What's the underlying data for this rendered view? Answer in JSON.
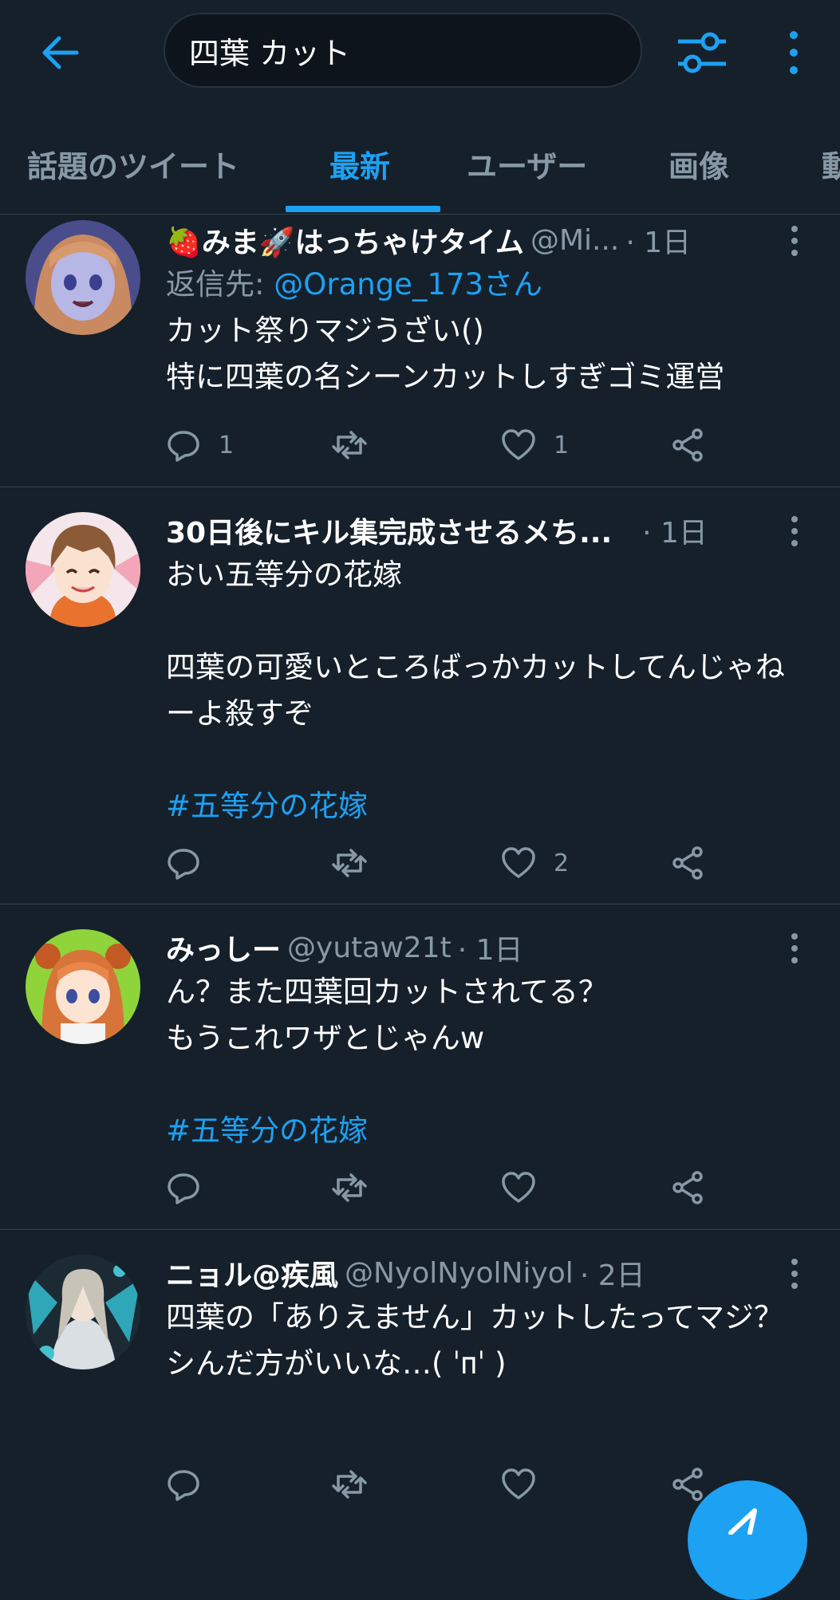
{
  "search": {
    "query": "四葉 カット"
  },
  "tabs": [
    "話題のツイート",
    "最新",
    "ユーザー",
    "画像",
    "動"
  ],
  "tweets": [
    {
      "name": "🍓みま🚀はっちゃけタイム",
      "handle": "@Mi...",
      "time": "· 1日",
      "reply_prefix": "返信先: ",
      "reply_to": "@Orange_173さん",
      "line1": "カット祭りマジうざい()",
      "line2": "特に四葉の名シーンカットしすぎゴミ運営",
      "replies": "1",
      "likes": "1"
    },
    {
      "name": "30日後にキル集完成させるメち...",
      "time": "· 1日",
      "line1": "おい五等分の花嫁",
      "line2": "四葉の可愛いところばっかカットしてんじゃねーよ殺すぞ",
      "hashtag": "#五等分の花嫁",
      "likes": "2"
    },
    {
      "name": "みっしー",
      "handle": "@yutaw21t",
      "time": "· 1日",
      "line1": "ん？また四葉回カットされてる？",
      "line2": "もうこれワザとじゃんw",
      "hashtag": "#五等分の花嫁"
    },
    {
      "name": "ニョル@疾風",
      "handle": "@NyolNyolNiyol",
      "time": "· 2日",
      "line1": "四葉の「ありえません」カットしたってマジ？",
      "line2": "シんだ方がいいな…( ˈᴨˈ )"
    }
  ],
  "colors": {
    "accent": "#1da1f2",
    "background": "#15202b",
    "muted": "#8899a6",
    "divider": "#38444d"
  }
}
